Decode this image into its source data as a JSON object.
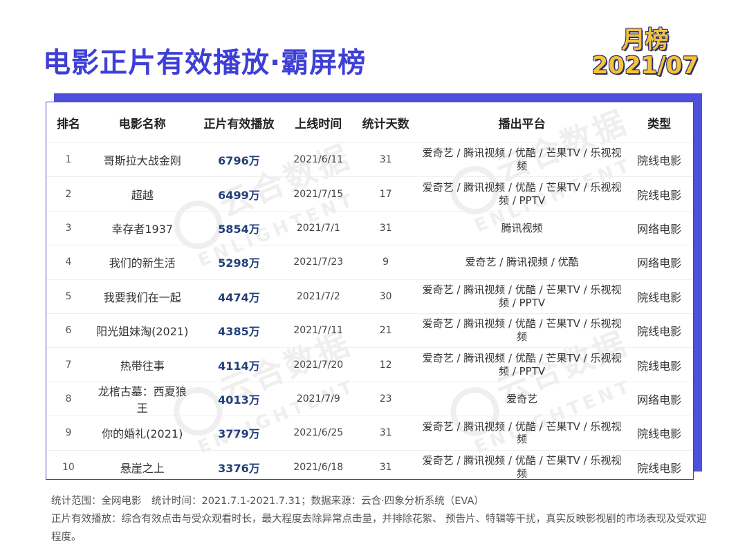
{
  "header": {
    "title": "电影正片有效播放·霸屏榜",
    "badge_line1": "月榜",
    "badge_line2": "2021/07"
  },
  "watermark": {
    "cn": "云合数据",
    "en": "ENLIGHTENT"
  },
  "table": {
    "columns": [
      "排名",
      "电影名称",
      "正片有效播放",
      "上线时间",
      "统计天数",
      "播出平台",
      "类型"
    ],
    "rows": [
      {
        "rank": "1",
        "name": "哥斯拉大战金刚",
        "views": "6796万",
        "date": "2021/6/11",
        "days": "31",
        "platform": "爱奇艺 / 腾讯视频 / 优酷 / 芒果TV / 乐视视频",
        "type": "院线电影"
      },
      {
        "rank": "2",
        "name": "超越",
        "views": "6499万",
        "date": "2021/7/15",
        "days": "17",
        "platform": "爱奇艺 / 腾讯视频 / 优酷 / 芒果TV / 乐视视频 / PPTV",
        "type": "院线电影"
      },
      {
        "rank": "3",
        "name": "幸存者1937",
        "views": "5854万",
        "date": "2021/7/1",
        "days": "31",
        "platform": "腾讯视频",
        "type": "网络电影"
      },
      {
        "rank": "4",
        "name": "我们的新生活",
        "views": "5298万",
        "date": "2021/7/23",
        "days": "9",
        "platform": "爱奇艺 / 腾讯视频 / 优酷",
        "type": "网络电影"
      },
      {
        "rank": "5",
        "name": "我要我们在一起",
        "views": "4474万",
        "date": "2021/7/2",
        "days": "30",
        "platform": "爱奇艺 / 腾讯视频 / 优酷 / 芒果TV / 乐视视频 / PPTV",
        "type": "院线电影"
      },
      {
        "rank": "6",
        "name": "阳光姐妹淘(2021)",
        "views": "4385万",
        "date": "2021/7/11",
        "days": "21",
        "platform": "爱奇艺 / 腾讯视频 / 优酷 / 芒果TV / 乐视视频",
        "type": "院线电影"
      },
      {
        "rank": "7",
        "name": "热带往事",
        "views": "4114万",
        "date": "2021/7/20",
        "days": "12",
        "platform": "爱奇艺 / 腾讯视频 / 优酷 / 芒果TV / 乐视视频 / PPTV",
        "type": "院线电影"
      },
      {
        "rank": "8",
        "name": "龙棺古墓：西夏狼王",
        "views": "4013万",
        "date": "2021/7/9",
        "days": "23",
        "platform": "爱奇艺",
        "type": "网络电影"
      },
      {
        "rank": "9",
        "name": "你的婚礼(2021)",
        "views": "3779万",
        "date": "2021/6/25",
        "days": "31",
        "platform": "爱奇艺 / 腾讯视频 / 优酷 / 芒果TV / 乐视视频",
        "type": "院线电影"
      },
      {
        "rank": "10",
        "name": "悬崖之上",
        "views": "3376万",
        "date": "2021/6/18",
        "days": "31",
        "platform": "爱奇艺 / 腾讯视频 / 优酷 / 芒果TV / 乐视视频",
        "type": "院线电影"
      }
    ]
  },
  "footer": {
    "line1": "统计范围：全网电影　统计时间：2021.7.1-2021.7.31；数据来源：云合·四象分析系统（EVA）",
    "line2": "正片有效播放：综合有效点击与受众观看时长，最大程度去除异常点击量，并排除花絮、 预告片、特辑等干扰，真实反映影视剧的市场表现及受欢迎程度。"
  },
  "colors": {
    "title": "#3d3fd6",
    "accent_block": "#4e4fdc",
    "badge_fill": "#f5c33b",
    "views_text": "#23407a"
  }
}
